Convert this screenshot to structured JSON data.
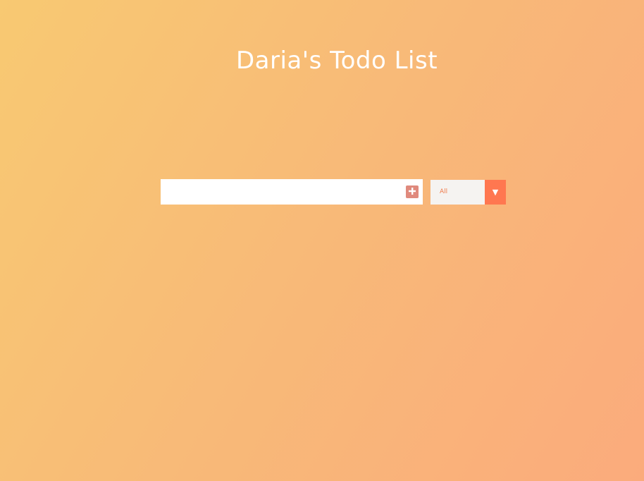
{
  "header": {
    "title": "Daria's Todo List"
  },
  "form": {
    "input_value": "",
    "input_placeholder": "",
    "add_icon": "plus-square-icon"
  },
  "filter": {
    "selected": "All",
    "arrow_glyph": "▼",
    "options": [
      "All"
    ]
  },
  "colors": {
    "gradient_start": "#f8c972",
    "gradient_end": "#fbab7c",
    "add_button": "#e08a7d",
    "select_arrow_bg": "#ff7750",
    "select_text": "#f07a4a"
  }
}
